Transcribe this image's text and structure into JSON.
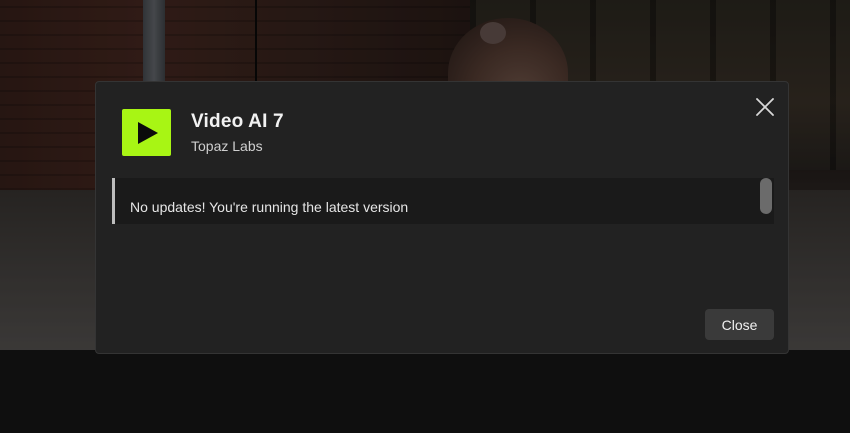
{
  "dialog": {
    "app_name": "Video AI 7",
    "publisher": "Topaz Labs",
    "icon": "play-icon",
    "accent_color": "#a8f514",
    "message": "No updates! You're running the latest version",
    "close_button_label": "Close",
    "close_icon": "close-icon"
  }
}
